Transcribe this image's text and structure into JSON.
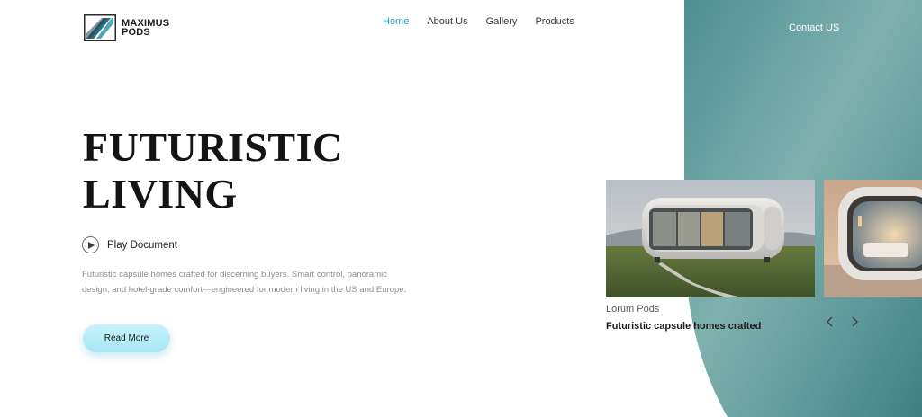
{
  "brand": {
    "name_line1": "MAXIMUS",
    "name_line2": "PODS",
    "logo_icon": "diagonal-stripes-logo-icon"
  },
  "nav": {
    "items": [
      {
        "label": "Home",
        "active": true
      },
      {
        "label": "About Us",
        "active": false
      },
      {
        "label": "Gallery",
        "active": false
      },
      {
        "label": "Products",
        "active": false
      }
    ],
    "contact_label": "Contact US"
  },
  "hero": {
    "title_line1": "FUTURISTIC",
    "title_line2": "LIVING",
    "play_label": "Play Document",
    "play_icon": "play-icon",
    "description": "Futuristic capsule homes crafted for discerning buyers. Smart control, panoramic design, and hotel-grade comfort—engineered for modern living in the US and Europe.",
    "cta_label": "Read More"
  },
  "carousel": {
    "card_subtitle": "Lorum Pods",
    "card_title": "Futuristic capsule homes crafted",
    "prev_icon": "chevron-left-icon",
    "next_icon": "chevron-right-icon"
  },
  "colors": {
    "accent": "#2aa3b8",
    "panel_teal_dark": "#4e8f93",
    "panel_teal_light": "#8fbdb8",
    "cta_bg": "#b9eef8",
    "title_text": "#141414",
    "body_text": "#8d8d8d"
  }
}
